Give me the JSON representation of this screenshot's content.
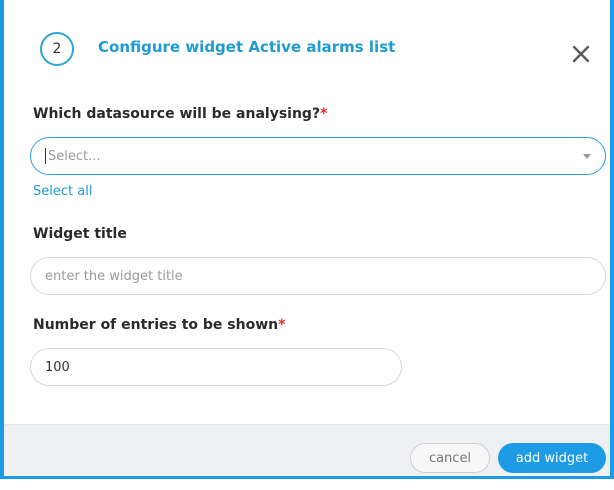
{
  "dialog": {
    "step_number": "2",
    "title": "Configure widget Active alarms list",
    "close_icon": "close-icon"
  },
  "datasource": {
    "label": "Which datasource will be analysing?",
    "required_marker": "*",
    "placeholder": "Select...",
    "select_all_label": "Select all"
  },
  "widget_title": {
    "label": "Widget title",
    "placeholder": "enter the widget title",
    "value": ""
  },
  "entries": {
    "label": "Number of entries to be shown",
    "required_marker": "*",
    "value": "100"
  },
  "footer": {
    "cancel_label": "cancel",
    "add_label": "add widget"
  },
  "colors": {
    "accent": "#1e9be5",
    "required": "#e02b2b",
    "footer_bg": "#eef0f3"
  }
}
